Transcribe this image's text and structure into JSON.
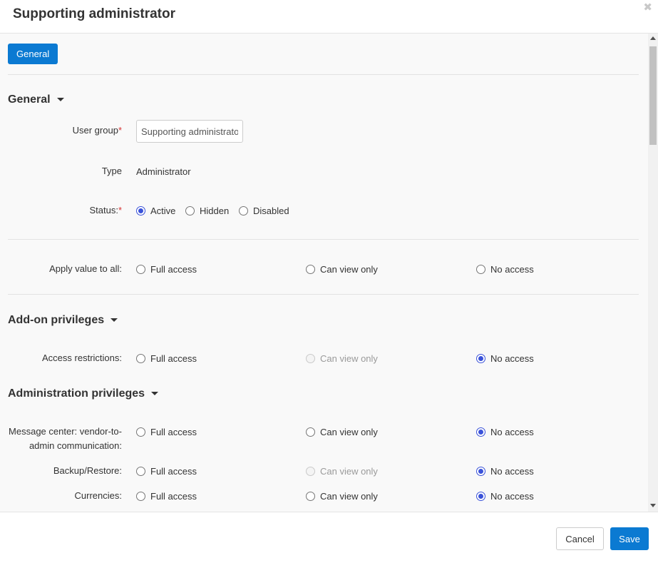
{
  "dialog": {
    "title": "Supporting administrator",
    "close_icon": "close-icon"
  },
  "tabs": [
    {
      "label": "General"
    }
  ],
  "general": {
    "section_title": "General",
    "user_group": {
      "label": "User group",
      "value": "Supporting administrator"
    },
    "type": {
      "label": "Type",
      "value": "Administrator"
    },
    "status": {
      "label": "Status:",
      "options": [
        "Active",
        "Hidden",
        "Disabled"
      ],
      "selected": "Active"
    }
  },
  "apply_all": {
    "label": "Apply value to all:",
    "options": [
      "Full access",
      "Can view only",
      "No access"
    ]
  },
  "addon": {
    "section_title": "Add-on privileges",
    "rows": [
      {
        "label": "Access restrictions:",
        "selected": "No access",
        "view_disabled": true
      }
    ]
  },
  "admin": {
    "section_title": "Administration privileges",
    "rows": [
      {
        "label_line1": "Message center: vendor-to-",
        "label_line2": "admin communication:",
        "selected": "No access",
        "view_disabled": false
      },
      {
        "label": "Backup/Restore:",
        "selected": "No access",
        "view_disabled": true
      },
      {
        "label": "Currencies:",
        "selected": "No access",
        "view_disabled": false
      }
    ]
  },
  "access_options": {
    "full": "Full access",
    "view": "Can view only",
    "none": "No access"
  },
  "footer": {
    "cancel_label": "Cancel",
    "save_label": "Save"
  },
  "colors": {
    "primary": "#0b7ad2",
    "radio_selected": "#3a52d9",
    "required": "#d63333"
  }
}
